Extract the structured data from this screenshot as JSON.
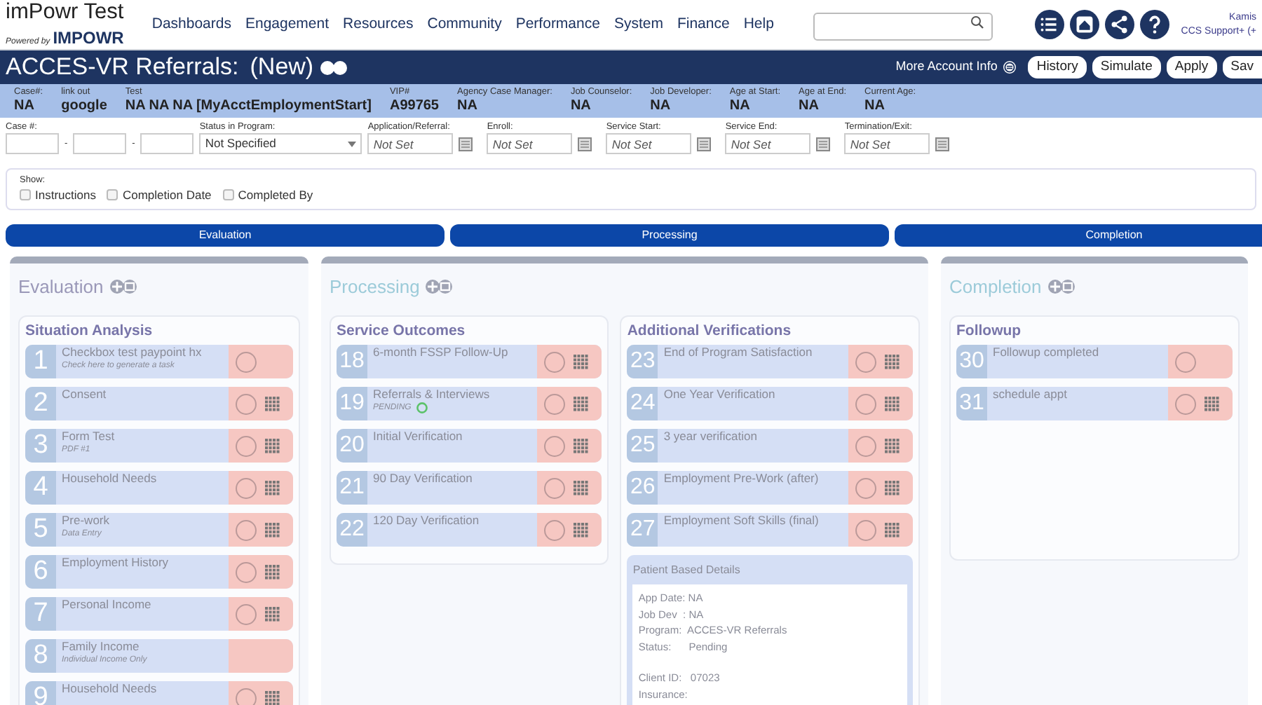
{
  "brand": {
    "title": "imPowr Test",
    "powered_by": "Powered by",
    "powered_brand": "IMPOWR"
  },
  "menu": [
    "Dashboards",
    "Engagement",
    "Resources",
    "Community",
    "Performance",
    "System",
    "Finance",
    "Help"
  ],
  "user": {
    "name": "Kamis",
    "role": "CCS Support+ (+"
  },
  "header": {
    "title": "ACCES-VR Referrals:",
    "status": "(New)",
    "more_info": "More Account Info",
    "buttons": [
      "History",
      "Simulate",
      "Apply",
      "Sav"
    ]
  },
  "info": [
    {
      "label": "Case#:",
      "value": "NA"
    },
    {
      "label": "link out",
      "value": "google"
    },
    {
      "label": "Test",
      "value": "NA NA NA [MyAcctEmploymentStart]"
    },
    {
      "label": "VIP#",
      "value": "A99765"
    },
    {
      "label": "Agency Case Manager:",
      "value": "NA"
    },
    {
      "label": "Job Counselor:",
      "value": "NA"
    },
    {
      "label": "Job Developer:",
      "value": "NA"
    },
    {
      "label": "Age at Start:",
      "value": "NA"
    },
    {
      "label": "Age at End:",
      "value": "NA"
    },
    {
      "label": "Current Age:",
      "value": "NA"
    }
  ],
  "fields": [
    {
      "kind": "case",
      "label": "Case #:",
      "separators": [
        "-",
        "-"
      ]
    },
    {
      "kind": "select",
      "label": "Status in Program:",
      "value": "Not Specified"
    },
    {
      "kind": "date",
      "label": "Application/Referral:",
      "placeholder": "Not Set"
    },
    {
      "kind": "date",
      "label": "Enroll:",
      "placeholder": "Not Set"
    },
    {
      "kind": "date",
      "label": "Service Start:",
      "placeholder": "Not Set"
    },
    {
      "kind": "date",
      "label": "Service End:",
      "placeholder": "Not Set"
    },
    {
      "kind": "date",
      "label": "Termination/Exit:",
      "placeholder": "Not Set"
    }
  ],
  "show": {
    "label": "Show:",
    "options": [
      {
        "label": "Instructions",
        "checked": false
      },
      {
        "label": "Completion Date",
        "checked": false
      },
      {
        "label": "Completed By",
        "checked": false
      }
    ]
  },
  "phase_tabs": [
    "Evaluation",
    "Processing",
    "Completion"
  ],
  "phases": [
    {
      "title": "Evaluation",
      "color": "#9a98b8",
      "groups": [
        {
          "title": "Situation Analysis",
          "tasks": [
            {
              "number": "1",
              "title": "Checkbox test paypoint hx",
              "subtitle": "Check here to generate a task",
              "has_circle": true,
              "has_grid": false
            },
            {
              "number": "2",
              "title": "Consent",
              "has_circle": true,
              "has_grid": true
            },
            {
              "number": "3",
              "title": "Form Test",
              "subtitle": "PDF #1",
              "has_circle": true,
              "has_grid": true
            },
            {
              "number": "4",
              "title": "Household Needs",
              "has_circle": true,
              "has_grid": true
            },
            {
              "number": "5",
              "title": "Pre-work",
              "subtitle": "Data Entry",
              "has_circle": true,
              "has_grid": true
            },
            {
              "number": "6",
              "title": "Employment History",
              "has_circle": true,
              "has_grid": true
            },
            {
              "number": "7",
              "title": "Personal Income",
              "has_circle": true,
              "has_grid": true
            },
            {
              "number": "8",
              "title": "Family Income",
              "subtitle": "Individual Income Only",
              "has_circle": false,
              "has_grid": false
            },
            {
              "number": "9",
              "title": "Household Needs",
              "has_circle": true,
              "has_grid": true
            }
          ]
        }
      ]
    },
    {
      "title": "Processing",
      "color": "#9ccbd9",
      "groups": [
        {
          "title": "Service Outcomes",
          "tasks": [
            {
              "number": "18",
              "title": "6-month FSSP Follow-Up",
              "has_circle": true,
              "has_grid": true
            },
            {
              "number": "19",
              "title": "Referrals & Interviews",
              "subtitle": "PENDING",
              "thumbs_up": true,
              "has_circle": true,
              "has_grid": true
            },
            {
              "number": "20",
              "title": "Initial Verification",
              "has_circle": true,
              "has_grid": true
            },
            {
              "number": "21",
              "title": "90 Day Verification",
              "has_circle": true,
              "has_grid": true
            },
            {
              "number": "22",
              "title": "120 Day Verification",
              "has_circle": true,
              "has_grid": true
            }
          ]
        },
        {
          "title": "Additional Verifications",
          "tasks": [
            {
              "number": "23",
              "title": "End of Program Satisfaction",
              "has_circle": true,
              "has_grid": true
            },
            {
              "number": "24",
              "title": "One Year Verification",
              "has_circle": true,
              "has_grid": true
            },
            {
              "number": "25",
              "title": "3 year verification",
              "has_circle": true,
              "has_grid": true
            },
            {
              "number": "26",
              "title": "Employment Pre-Work (after)",
              "has_circle": true,
              "has_grid": true
            },
            {
              "number": "27",
              "title": "Employment Soft Skills (final)",
              "has_circle": true,
              "has_grid": true
            }
          ],
          "details": {
            "title": "Patient Based Details",
            "lines": [
              {
                "text": "App Date: NA"
              },
              {
                "text": "Job Dev  : NA"
              },
              {
                "text": "Program:  ACCES-VR Referrals"
              },
              {
                "text": "Status:      Pending"
              },
              {
                "text": "Client ID:   07023",
                "spaced": true
              },
              {
                "text": "Insurance:"
              }
            ]
          }
        }
      ]
    },
    {
      "title": "Completion",
      "color": "#9ccbd9",
      "groups": [
        {
          "title": "Followup",
          "tall": true,
          "tasks": [
            {
              "number": "30",
              "title": "Followup completed",
              "has_circle": true,
              "has_grid": false
            },
            {
              "number": "31",
              "title": "schedule appt",
              "has_circle": true,
              "has_grid": true
            }
          ]
        }
      ]
    }
  ]
}
